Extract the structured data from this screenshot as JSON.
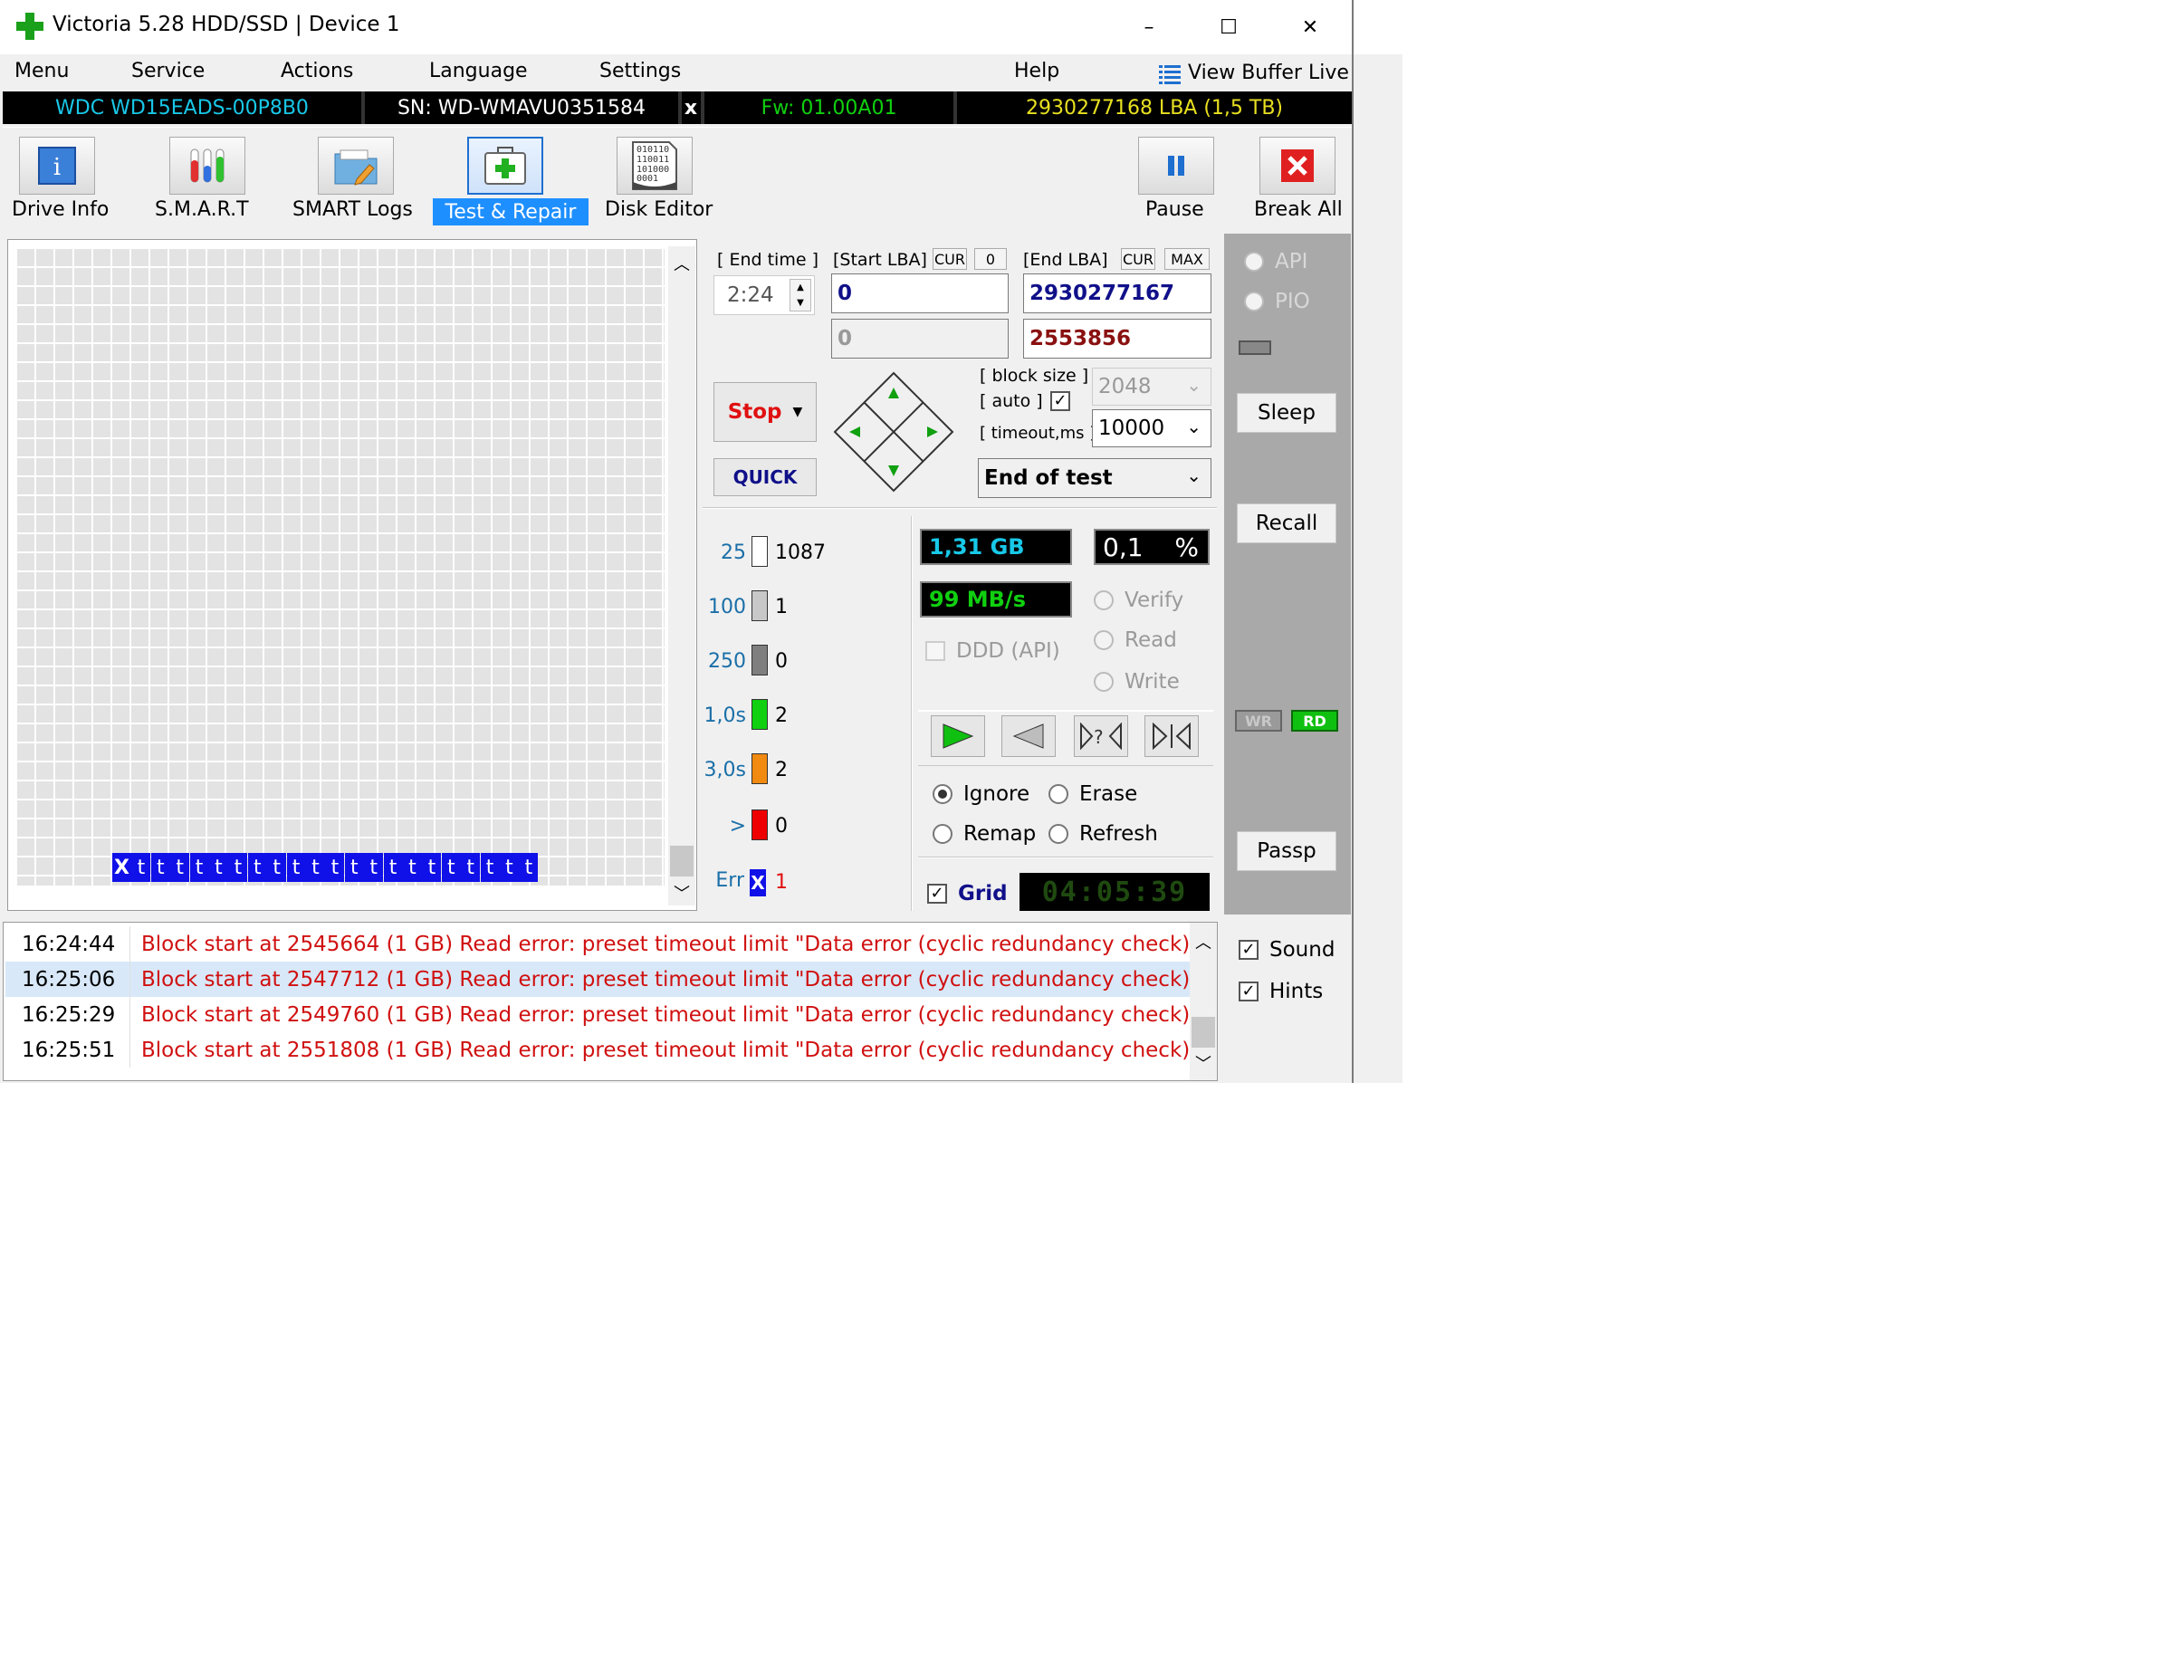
{
  "window": {
    "title": "Victoria 5.28 HDD/SSD | Device 1",
    "minimize_glyph": "–",
    "maximize_glyph": "☐",
    "close_glyph": "✕"
  },
  "menu": {
    "items": [
      "Menu",
      "Service",
      "Actions",
      "Language",
      "Settings",
      "Help"
    ],
    "view_buffer": "View Buffer Live"
  },
  "device": {
    "model": "WDC WD15EADS-00P8B0",
    "serial": "SN: WD-WMAVU0351584",
    "x": "x",
    "firmware": "Fw: 01.00A01",
    "capacity": "2930277168 LBA (1,5 TB)"
  },
  "toolbar": {
    "drive_info": "Drive Info",
    "smart": "S.M.A.R.T",
    "smart_logs": "SMART Logs",
    "test_repair": "Test & Repair",
    "disk_editor": "Disk Editor",
    "pause": "Pause",
    "break_all": "Break All",
    "disk_editor_bits": "010110\n110011\n101000\n0001"
  },
  "scan": {
    "end_time_label": "[ End time ]",
    "end_time_value": "2:24",
    "start_lba_label": "[Start LBA]",
    "cur_label": "CUR",
    "zero_label": "0",
    "end_lba_label": "[End LBA]",
    "max_label": "MAX",
    "start_lba": "0",
    "end_lba": "2930277167",
    "current_lba": "0",
    "current_end": "2553856",
    "block_size_label": "[ block size ]",
    "auto_label": "[ auto ]",
    "block_size": "2048",
    "timeout_label": "[ timeout,ms ]",
    "timeout": "10000",
    "stop_label": "Stop",
    "quick_label": "QUICK",
    "end_action": "End of test"
  },
  "stats": [
    {
      "label": "25",
      "count": "1087",
      "color": "#ffffff"
    },
    {
      "label": "100",
      "count": "1",
      "color": "#c8c8c8"
    },
    {
      "label": "250",
      "count": "0",
      "color": "#7f7f7f"
    },
    {
      "label": "1,0s",
      "count": "2",
      "color": "#10d010"
    },
    {
      "label": "3,0s",
      "count": "2",
      "color": "#f08a10"
    },
    {
      "label": ">",
      "count": "0",
      "color": "#ee0000"
    }
  ],
  "err": {
    "label": "Err",
    "count": "1",
    "glyph": "X"
  },
  "progress": {
    "size": "1,31 GB",
    "percent": "0,1",
    "percent_sign": "%",
    "speed": "99 MB/s"
  },
  "modes": {
    "verify": "Verify",
    "read": "Read",
    "write": "Write",
    "ddd": "DDD (API)"
  },
  "actions": {
    "ignore": "Ignore",
    "erase": "Erase",
    "remap": "Remap",
    "refresh": "Refresh"
  },
  "grid_label": "Grid",
  "clock": "04:05:39",
  "map_blocks": [
    "X",
    "t",
    "t",
    "t",
    "t",
    "t",
    "t",
    "t",
    "t",
    "t",
    "t",
    "t",
    "t",
    "t",
    "t",
    "t",
    "t",
    "t",
    "t",
    "t",
    "t",
    "t"
  ],
  "side": {
    "api": "API",
    "pio": "PIO",
    "sleep": "Sleep",
    "recall": "Recall",
    "wr": "WR",
    "rd": "RD",
    "passp": "Passp",
    "sound": "Sound",
    "hints": "Hints"
  },
  "log": [
    {
      "time": "16:24:44",
      "msg": "Block start at 2545664 (1 GB) Read error: preset timeout limit \"Data error (cyclic redundancy check)\""
    },
    {
      "time": "16:25:06",
      "msg": "Block start at 2547712 (1 GB) Read error: preset timeout limit \"Data error (cyclic redundancy check)\""
    },
    {
      "time": "16:25:29",
      "msg": "Block start at 2549760 (1 GB) Read error: preset timeout limit \"Data error (cyclic redundancy check)\""
    },
    {
      "time": "16:25:51",
      "msg": "Block start at 2551808 (1 GB) Read error: preset timeout limit \"Data error (cyclic redundancy check)\""
    }
  ],
  "colors": {
    "device_model": "#18c8e8",
    "firmware": "#10d010",
    "capacity": "#e8e020",
    "log_error": "#d01010",
    "active_tab": "#1e8fff"
  }
}
